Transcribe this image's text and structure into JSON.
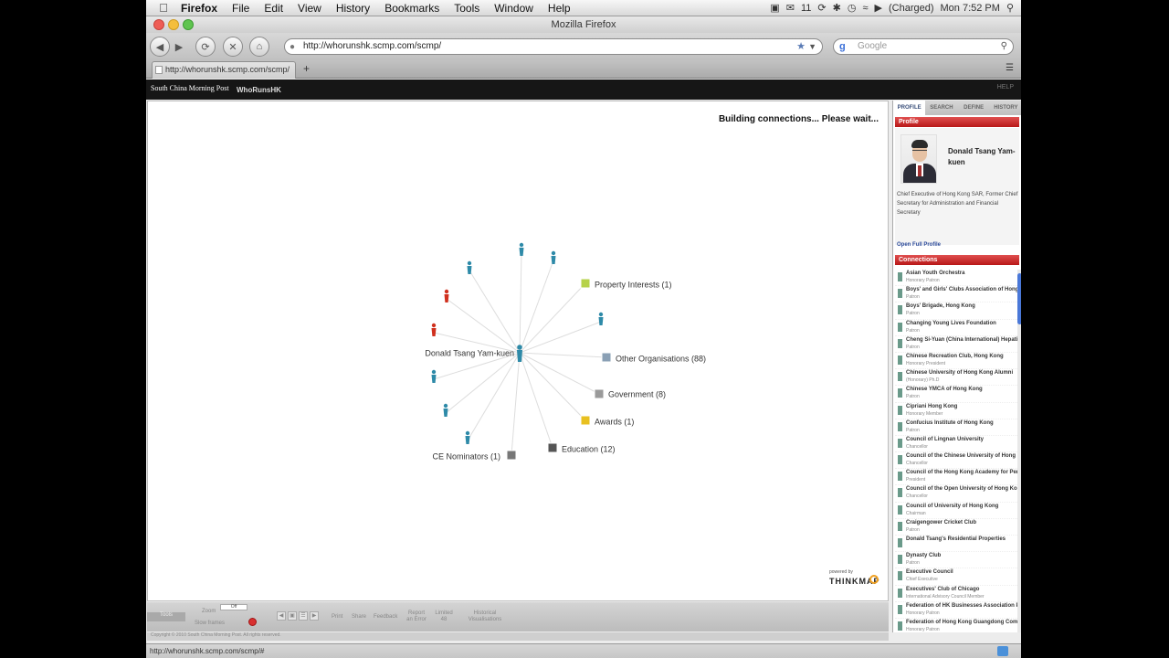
{
  "menubar": {
    "app_name": "Firefox",
    "items": [
      "File",
      "Edit",
      "View",
      "History",
      "Bookmarks",
      "Tools",
      "Window",
      "Help"
    ],
    "battery": "(Charged)",
    "clock": "Mon 7:52 PM",
    "mail_count": "11"
  },
  "window": {
    "title": "Mozilla Firefox"
  },
  "toolbar": {
    "url": "http://whorunshk.scmp.com/scmp/",
    "search_placeholder": "Google"
  },
  "tabs": [
    {
      "label": "http://whorunshk.scmp.com/scmp/"
    }
  ],
  "site": {
    "logo_text": "South China Morning Post",
    "brand_text": "WhoRunsHK",
    "help_label": "HELP"
  },
  "graph": {
    "status": "Building connections... Please wait...",
    "center_name": "Donald Tsang Yam-kuen",
    "categories": [
      {
        "label": "Property Interests (1)",
        "color": "#b6d24a"
      },
      {
        "label": "Other Organisations (88)",
        "color": "#8aa0b5"
      },
      {
        "label": "Government (8)",
        "color": "#9a9a9a"
      },
      {
        "label": "Awards (1)",
        "color": "#e8c020"
      },
      {
        "label": "Education (12)",
        "color": "#555555"
      },
      {
        "label": "CE Nominators (1)",
        "color": "#777777"
      }
    ],
    "person_colors": {
      "normal": "#2e8aa8",
      "highlight": "#d0301e"
    },
    "powered_by": "powered by",
    "thinkmap": "THINKMAP"
  },
  "tools": {
    "tools_label": "Tools",
    "zoom_label": "Zoom",
    "off_label": "Off",
    "slow_label": "Slow frames",
    "print": "Print",
    "share": "Share",
    "feedback": "Feedback",
    "report": "Report an Error",
    "limited": "Limited 48",
    "historical": "Historical Visualisations",
    "copyright": "Copyright © 2010 South China Morning Post. All rights reserved."
  },
  "panel": {
    "tabs": [
      "PROFILE",
      "SEARCH",
      "DEFINE",
      "HISTORY"
    ],
    "profile_header": "Profile",
    "name": "Donald Tsang Yam-kuen",
    "description": "Chief Executive of Hong Kong SAR, Former Chief Secretary for Administration and Financial Secretary",
    "open_full_profile": "Open Full Profile",
    "connections_header": "Connections",
    "connections": [
      {
        "name": "Asian Youth Orchestra",
        "role": "Honorary Patron"
      },
      {
        "name": "Boys' and Girls' Clubs Association of Hong Kong",
        "role": "Patron"
      },
      {
        "name": "Boys' Brigade, Hong Kong",
        "role": "Patron"
      },
      {
        "name": "Changing Young Lives Foundation",
        "role": "Patron"
      },
      {
        "name": "Cheng Si-Yuan (China International) Hepatitis",
        "role": "Patron"
      },
      {
        "name": "Chinese Recreation Club, Hong Kong",
        "role": "Honorary President"
      },
      {
        "name": "Chinese University of Hong Kong Alumni",
        "role": "(Honorary) Ph.D"
      },
      {
        "name": "Chinese YMCA of Hong Kong",
        "role": "Patron"
      },
      {
        "name": "Cipriani Hong Kong",
        "role": "Honorary Member"
      },
      {
        "name": "Confucius Institute of Hong Kong",
        "role": "Patron"
      },
      {
        "name": "Council of Lingnan University",
        "role": "Chancellor"
      },
      {
        "name": "Council of the Chinese University of Hong Kong",
        "role": "Chancellor"
      },
      {
        "name": "Council of the Hong Kong Academy for Performing Arts",
        "role": "President"
      },
      {
        "name": "Council of the Open University of Hong Kong",
        "role": "Chancellor"
      },
      {
        "name": "Council of University of Hong Kong",
        "role": "Chairman"
      },
      {
        "name": "Craigengower Cricket Club",
        "role": "Patron"
      },
      {
        "name": "Donald Tsang's Residential Properties",
        "role": ""
      },
      {
        "name": "Dynasty Club",
        "role": "Patron"
      },
      {
        "name": "Executive Council",
        "role": "Chief Executive"
      },
      {
        "name": "Executives' Club of Chicago",
        "role": "International Advisory Council Member"
      },
      {
        "name": "Federation of HK Businesses Association Part",
        "role": "Honorary Patron"
      },
      {
        "name": "Federation of Hong Kong Guangdong Community",
        "role": "Honorary Patron"
      }
    ]
  },
  "statusbar": {
    "url": "http://whorunshk.scmp.com/scmp/#"
  }
}
